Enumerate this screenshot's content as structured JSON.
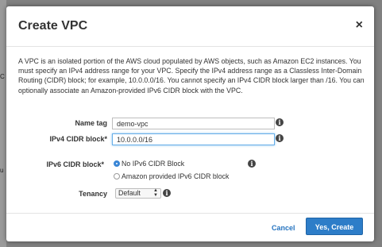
{
  "dialog": {
    "title": "Create VPC",
    "close_glyph": "×",
    "intro": "A VPC is an isolated portion of the AWS cloud populated by AWS objects, such as Amazon EC2 instances. You must specify an IPv4 address range for your VPC. Specify the IPv4 address range as a Classless Inter-Domain Routing (CIDR) block; for example, 10.0.0.0/16. You cannot specify an IPv4 CIDR block larger than /16. You can optionally associate an Amazon-provided IPv6 CIDR block with the VPC."
  },
  "form": {
    "name_tag": {
      "label": "Name tag",
      "value": "demo-vpc"
    },
    "ipv4_cidr": {
      "label": "IPv4 CIDR block*",
      "value": "10.0.0.0/16"
    },
    "ipv6_cidr": {
      "label": "IPv6 CIDR block*",
      "options": [
        {
          "label": "No IPv6 CIDR Block",
          "selected": true
        },
        {
          "label": "Amazon provided IPv6 CIDR block",
          "selected": false
        }
      ]
    },
    "tenancy": {
      "label": "Tenancy",
      "value": "Default",
      "arrows": "▲\n▼"
    },
    "info_glyph": "i"
  },
  "footer": {
    "cancel_label": "Cancel",
    "submit_label": "Yes, Create"
  },
  "background_edge_text": [
    "C",
    "u"
  ],
  "colors": {
    "primary": "#2d7dc8",
    "link": "#2674c0",
    "radio_selected": "#3a86d6"
  }
}
